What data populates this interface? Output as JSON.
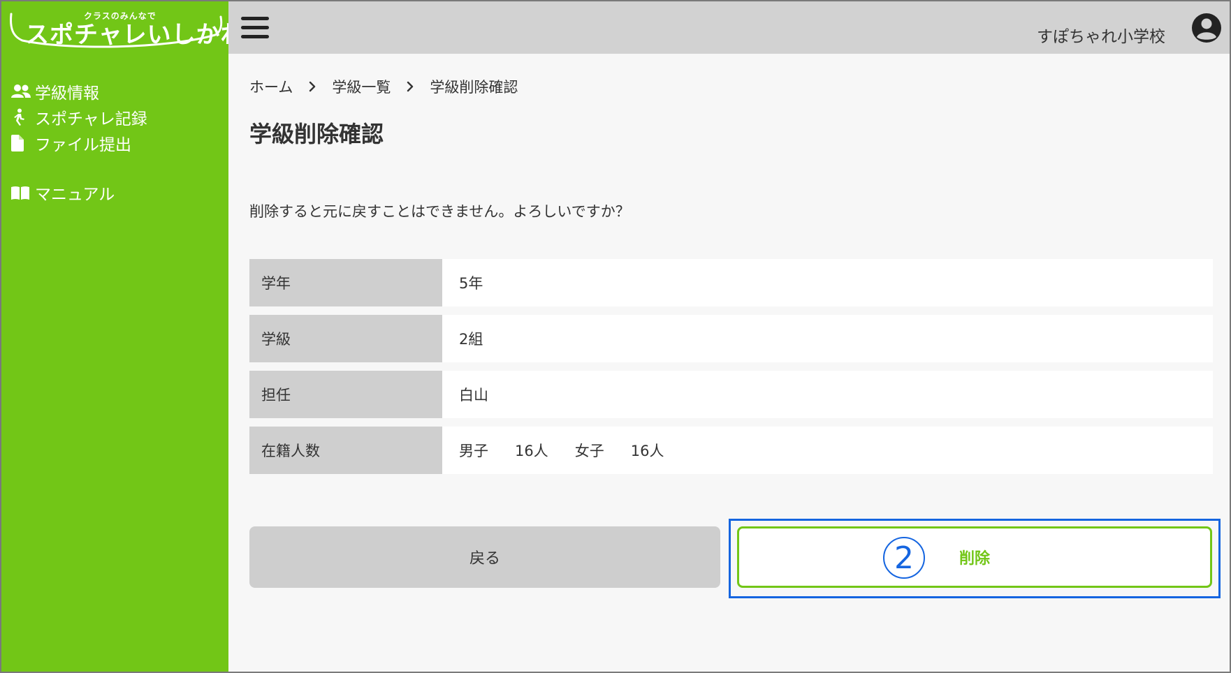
{
  "sidebar": {
    "logo_sub": "クラスのみんなで",
    "logo_main": "スポチャレいしかわ",
    "items": [
      {
        "label": "学級情報",
        "icon": "users-icon"
      },
      {
        "label": "スポチャレ記録",
        "icon": "walking-person-icon"
      },
      {
        "label": "ファイル提出",
        "icon": "file-icon"
      },
      {
        "label": "マニュアル",
        "icon": "book-icon"
      }
    ]
  },
  "header": {
    "school_name": "すぽちゃれ小学校"
  },
  "breadcrumb": {
    "items": [
      "ホーム",
      "学級一覧",
      "学級削除確認"
    ]
  },
  "page": {
    "title": "学級削除確認",
    "message": "削除すると元に戻すことはできません。よろしいですか？"
  },
  "details": {
    "rows": [
      {
        "label": "学年",
        "value": "5年"
      },
      {
        "label": "学級",
        "value": "2組"
      },
      {
        "label": "担任",
        "value": "白山"
      }
    ],
    "enrollment": {
      "label": "在籍人数",
      "male_label": "男子",
      "male_count": "16人",
      "female_label": "女子",
      "female_count": "16人"
    }
  },
  "actions": {
    "back_label": "戻る",
    "delete_label": "削除",
    "step_marker": "2"
  },
  "colors": {
    "brand_green": "#72c617",
    "highlight_blue": "#1565e0",
    "header_gray": "#d2d2d2"
  }
}
